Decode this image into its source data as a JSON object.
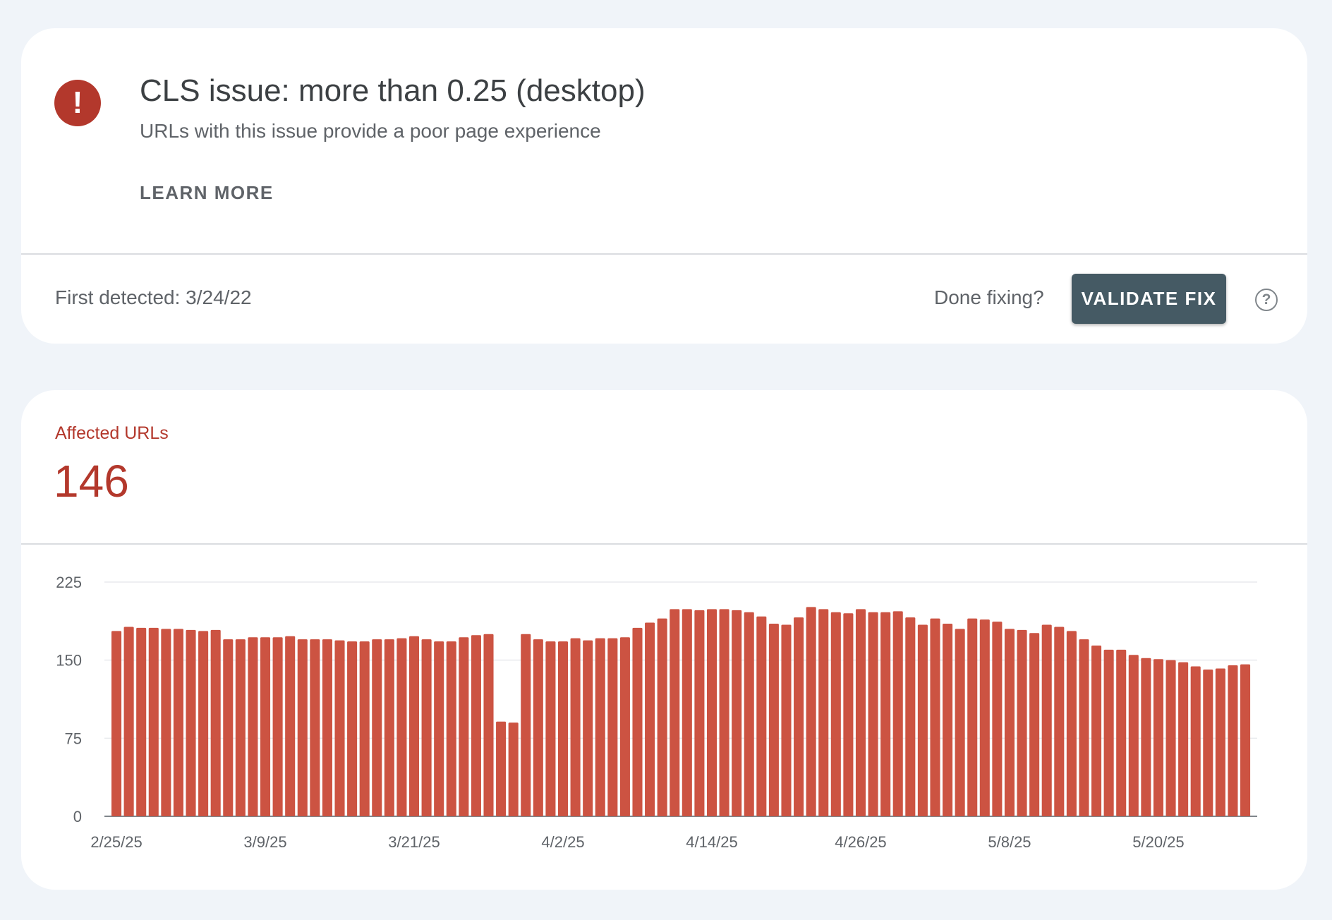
{
  "issue": {
    "icon": "error-icon",
    "icon_glyph": "!",
    "title": "CLS issue: more than 0.25 (desktop)",
    "subtitle": "URLs with this issue provide a poor page experience",
    "learn_more_label": "LEARN MORE",
    "first_detected": "First detected: 3/24/22",
    "done_fixing": "Done fixing?",
    "validate_fix_label": "VALIDATE FIX",
    "help_icon": "help-circle-icon",
    "help_glyph": "?"
  },
  "affected": {
    "label": "Affected URLs",
    "count": "146"
  },
  "colors": {
    "error": "#b3382c",
    "bar": "#cc5342",
    "button": "#455a64",
    "background": "#f0f4f9"
  },
  "chart_data": {
    "type": "bar",
    "title": "",
    "xlabel": "",
    "ylabel": "",
    "ylim": [
      0,
      225
    ],
    "yticks": [
      "225",
      "150",
      "75",
      "0"
    ],
    "grid": true,
    "x_tick_labels": [
      "2/25/25",
      "3/9/25",
      "3/21/25",
      "4/2/25",
      "4/14/25",
      "4/26/25",
      "5/8/25",
      "5/20/25"
    ],
    "categories": [
      "2/25/25",
      "2/26/25",
      "2/27/25",
      "2/28/25",
      "3/1/25",
      "3/2/25",
      "3/3/25",
      "3/4/25",
      "3/5/25",
      "3/6/25",
      "3/7/25",
      "3/8/25",
      "3/9/25",
      "3/10/25",
      "3/11/25",
      "3/12/25",
      "3/13/25",
      "3/14/25",
      "3/15/25",
      "3/16/25",
      "3/17/25",
      "3/18/25",
      "3/19/25",
      "3/20/25",
      "3/21/25",
      "3/22/25",
      "3/23/25",
      "3/24/25",
      "3/25/25",
      "3/26/25",
      "3/27/25",
      "3/28/25",
      "3/29/25",
      "3/30/25",
      "3/31/25",
      "4/1/25",
      "4/2/25",
      "4/3/25",
      "4/4/25",
      "4/5/25",
      "4/6/25",
      "4/7/25",
      "4/8/25",
      "4/9/25",
      "4/10/25",
      "4/11/25",
      "4/12/25",
      "4/13/25",
      "4/14/25",
      "4/15/25",
      "4/16/25",
      "4/17/25",
      "4/18/25",
      "4/19/25",
      "4/20/25",
      "4/21/25",
      "4/22/25",
      "4/23/25",
      "4/24/25",
      "4/25/25",
      "4/26/25",
      "4/27/25",
      "4/28/25",
      "4/29/25",
      "4/30/25",
      "5/1/25",
      "5/2/25",
      "5/3/25",
      "5/4/25",
      "5/5/25",
      "5/6/25",
      "5/7/25",
      "5/8/25",
      "5/9/25",
      "5/10/25",
      "5/11/25",
      "5/12/25",
      "5/13/25",
      "5/14/25",
      "5/15/25",
      "5/16/25",
      "5/17/25",
      "5/18/25",
      "5/19/25",
      "5/20/25",
      "5/21/25",
      "5/22/25",
      "5/23/25",
      "5/24/25",
      "5/25/25",
      "5/26/25"
    ],
    "values": [
      178,
      182,
      181,
      181,
      180,
      180,
      179,
      178,
      179,
      170,
      170,
      172,
      172,
      172,
      173,
      170,
      170,
      170,
      169,
      168,
      168,
      170,
      170,
      171,
      173,
      170,
      168,
      168,
      172,
      174,
      175,
      91,
      90,
      175,
      170,
      168,
      168,
      171,
      169,
      171,
      171,
      172,
      181,
      186,
      190,
      199,
      199,
      198,
      199,
      199,
      198,
      196,
      192,
      185,
      184,
      191,
      201,
      199,
      196,
      195,
      199,
      196,
      196,
      197,
      191,
      184,
      190,
      185,
      180,
      190,
      189,
      187,
      180,
      179,
      176,
      184,
      182,
      178,
      170,
      164,
      160,
      160,
      155,
      152,
      151,
      150,
      148,
      144,
      141,
      142,
      145,
      146
    ],
    "series": [
      {
        "values": []
      }
    ]
  }
}
